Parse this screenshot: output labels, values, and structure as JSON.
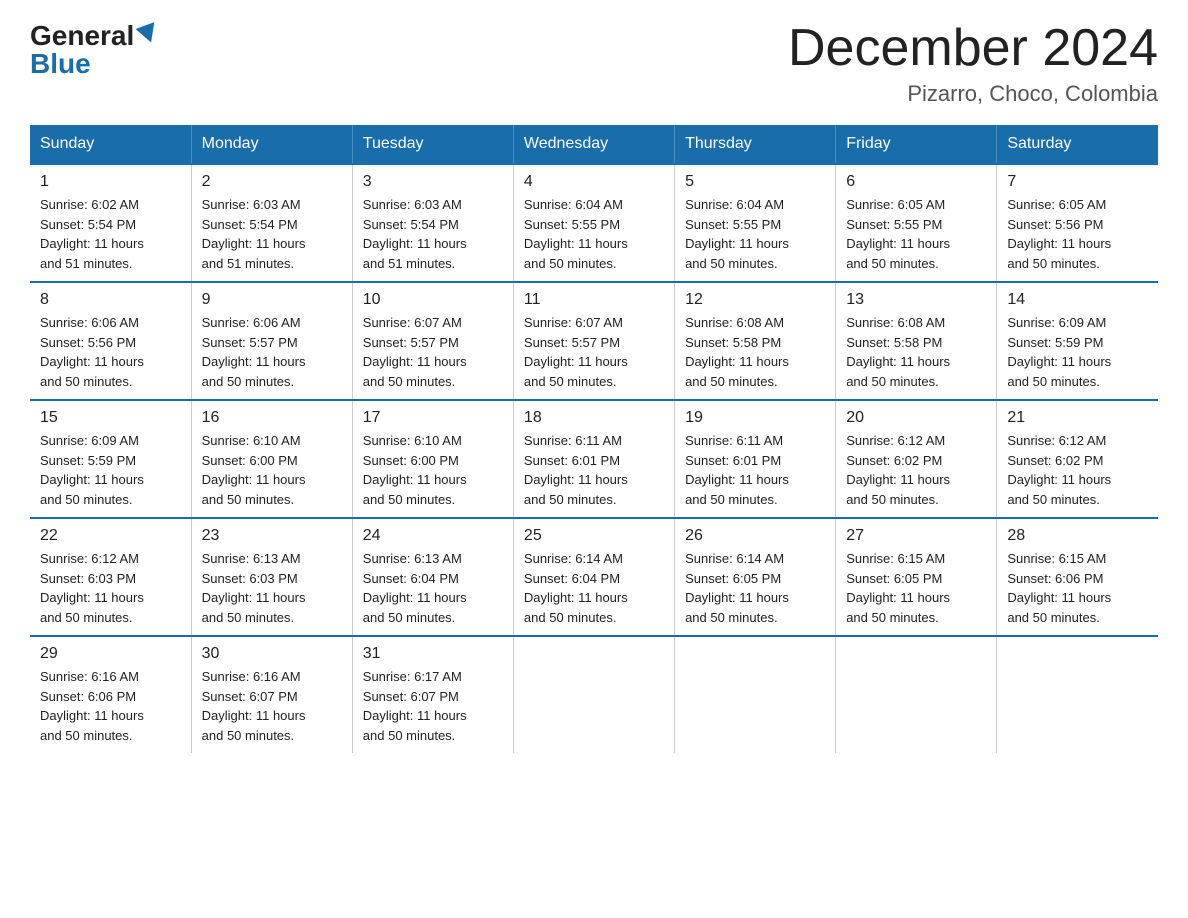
{
  "logo": {
    "general": "General",
    "blue": "Blue"
  },
  "title": "December 2024",
  "subtitle": "Pizarro, Choco, Colombia",
  "days_of_week": [
    "Sunday",
    "Monday",
    "Tuesday",
    "Wednesday",
    "Thursday",
    "Friday",
    "Saturday"
  ],
  "weeks": [
    [
      {
        "day": "1",
        "sunrise": "6:02 AM",
        "sunset": "5:54 PM",
        "daylight": "11 hours and 51 minutes."
      },
      {
        "day": "2",
        "sunrise": "6:03 AM",
        "sunset": "5:54 PM",
        "daylight": "11 hours and 51 minutes."
      },
      {
        "day": "3",
        "sunrise": "6:03 AM",
        "sunset": "5:54 PM",
        "daylight": "11 hours and 51 minutes."
      },
      {
        "day": "4",
        "sunrise": "6:04 AM",
        "sunset": "5:55 PM",
        "daylight": "11 hours and 50 minutes."
      },
      {
        "day": "5",
        "sunrise": "6:04 AM",
        "sunset": "5:55 PM",
        "daylight": "11 hours and 50 minutes."
      },
      {
        "day": "6",
        "sunrise": "6:05 AM",
        "sunset": "5:55 PM",
        "daylight": "11 hours and 50 minutes."
      },
      {
        "day": "7",
        "sunrise": "6:05 AM",
        "sunset": "5:56 PM",
        "daylight": "11 hours and 50 minutes."
      }
    ],
    [
      {
        "day": "8",
        "sunrise": "6:06 AM",
        "sunset": "5:56 PM",
        "daylight": "11 hours and 50 minutes."
      },
      {
        "day": "9",
        "sunrise": "6:06 AM",
        "sunset": "5:57 PM",
        "daylight": "11 hours and 50 minutes."
      },
      {
        "day": "10",
        "sunrise": "6:07 AM",
        "sunset": "5:57 PM",
        "daylight": "11 hours and 50 minutes."
      },
      {
        "day": "11",
        "sunrise": "6:07 AM",
        "sunset": "5:57 PM",
        "daylight": "11 hours and 50 minutes."
      },
      {
        "day": "12",
        "sunrise": "6:08 AM",
        "sunset": "5:58 PM",
        "daylight": "11 hours and 50 minutes."
      },
      {
        "day": "13",
        "sunrise": "6:08 AM",
        "sunset": "5:58 PM",
        "daylight": "11 hours and 50 minutes."
      },
      {
        "day": "14",
        "sunrise": "6:09 AM",
        "sunset": "5:59 PM",
        "daylight": "11 hours and 50 minutes."
      }
    ],
    [
      {
        "day": "15",
        "sunrise": "6:09 AM",
        "sunset": "5:59 PM",
        "daylight": "11 hours and 50 minutes."
      },
      {
        "day": "16",
        "sunrise": "6:10 AM",
        "sunset": "6:00 PM",
        "daylight": "11 hours and 50 minutes."
      },
      {
        "day": "17",
        "sunrise": "6:10 AM",
        "sunset": "6:00 PM",
        "daylight": "11 hours and 50 minutes."
      },
      {
        "day": "18",
        "sunrise": "6:11 AM",
        "sunset": "6:01 PM",
        "daylight": "11 hours and 50 minutes."
      },
      {
        "day": "19",
        "sunrise": "6:11 AM",
        "sunset": "6:01 PM",
        "daylight": "11 hours and 50 minutes."
      },
      {
        "day": "20",
        "sunrise": "6:12 AM",
        "sunset": "6:02 PM",
        "daylight": "11 hours and 50 minutes."
      },
      {
        "day": "21",
        "sunrise": "6:12 AM",
        "sunset": "6:02 PM",
        "daylight": "11 hours and 50 minutes."
      }
    ],
    [
      {
        "day": "22",
        "sunrise": "6:12 AM",
        "sunset": "6:03 PM",
        "daylight": "11 hours and 50 minutes."
      },
      {
        "day": "23",
        "sunrise": "6:13 AM",
        "sunset": "6:03 PM",
        "daylight": "11 hours and 50 minutes."
      },
      {
        "day": "24",
        "sunrise": "6:13 AM",
        "sunset": "6:04 PM",
        "daylight": "11 hours and 50 minutes."
      },
      {
        "day": "25",
        "sunrise": "6:14 AM",
        "sunset": "6:04 PM",
        "daylight": "11 hours and 50 minutes."
      },
      {
        "day": "26",
        "sunrise": "6:14 AM",
        "sunset": "6:05 PM",
        "daylight": "11 hours and 50 minutes."
      },
      {
        "day": "27",
        "sunrise": "6:15 AM",
        "sunset": "6:05 PM",
        "daylight": "11 hours and 50 minutes."
      },
      {
        "day": "28",
        "sunrise": "6:15 AM",
        "sunset": "6:06 PM",
        "daylight": "11 hours and 50 minutes."
      }
    ],
    [
      {
        "day": "29",
        "sunrise": "6:16 AM",
        "sunset": "6:06 PM",
        "daylight": "11 hours and 50 minutes."
      },
      {
        "day": "30",
        "sunrise": "6:16 AM",
        "sunset": "6:07 PM",
        "daylight": "11 hours and 50 minutes."
      },
      {
        "day": "31",
        "sunrise": "6:17 AM",
        "sunset": "6:07 PM",
        "daylight": "11 hours and 50 minutes."
      },
      null,
      null,
      null,
      null
    ]
  ],
  "labels": {
    "sunrise": "Sunrise:",
    "sunset": "Sunset:",
    "daylight": "Daylight:"
  }
}
